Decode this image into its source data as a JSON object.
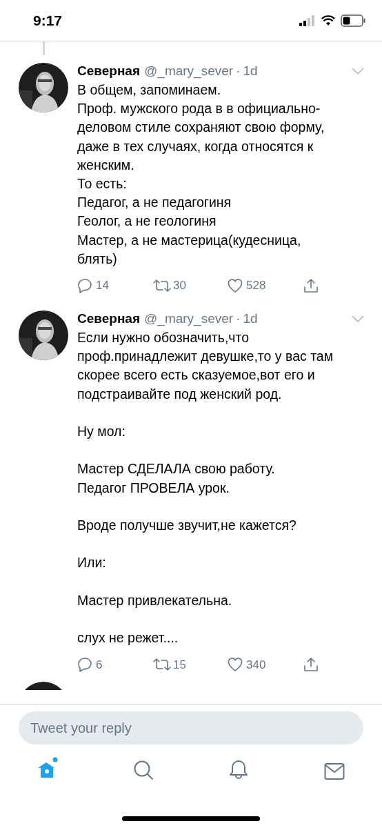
{
  "status_bar": {
    "time": "9:17"
  },
  "tweets": [
    {
      "name": "Северная",
      "handle": "@_mary_sever",
      "separator": "·",
      "time": "1d",
      "body": "В общем, запоминаем.\nПроф. мужского рода в в официально-\nделовом стиле сохраняют свою форму,\nдаже в тех случаях, когда относятся к\nженским.\nТо есть:\nПедагог, а не педагогиня\nГеолог, а не геологиня\nМастер, а не мастерица(кудесница,\nблять)",
      "replies": "14",
      "retweets": "30",
      "likes": "528"
    },
    {
      "name": "Северная",
      "handle": "@_mary_sever",
      "separator": "·",
      "time": "1d",
      "body": "Если нужно обозначить,что\nпроф.принадлежит девушке,то у вас там\nскорее всего есть сказуемое,вот его и\nподстраивайте под женский род.\n\nНу мол:\n\nМастер СДЕЛАЛА свою работу.\nПедагог ПРОВЕЛА урок.\n\nВроде получше звучит,не кажется?\n\nИли:\n\nМастер привлекательна.\n\nслух не режет....",
      "replies": "6",
      "retweets": "15",
      "likes": "340"
    }
  ],
  "reply_field": {
    "placeholder": "Tweet your reply"
  },
  "tab_bar": [
    {
      "kind": "home",
      "selected": true,
      "unread": true
    },
    {
      "kind": "search",
      "selected": false,
      "unread": false
    },
    {
      "kind": "notifications",
      "selected": false,
      "unread": false
    },
    {
      "kind": "messages",
      "selected": false,
      "unread": false
    }
  ]
}
